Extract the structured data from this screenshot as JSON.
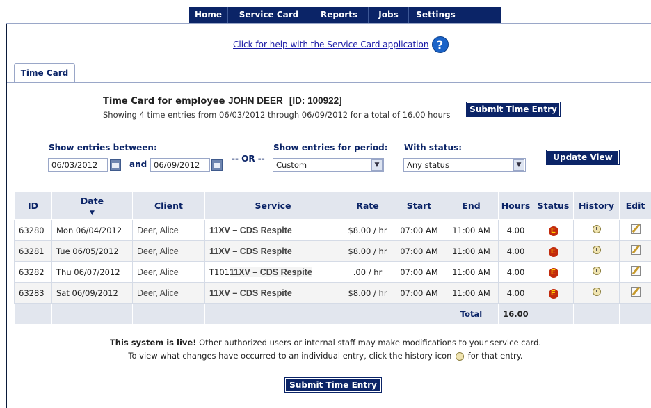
{
  "nav": {
    "items": [
      "Home",
      "Service Card",
      "Reports",
      "Jobs",
      "Settings"
    ]
  },
  "help": {
    "link": "Click for help with the Service Card application"
  },
  "tab": {
    "label": "Time Card"
  },
  "employee": {
    "prefix": "Time Card for employee",
    "name": "JOHN DEER",
    "id_label": "[ID: 100922]",
    "summary": "Showing 4 time entries from 06/03/2012 through 06/09/2012 for a total of 16.00 hours"
  },
  "buttons": {
    "submit_top": "Submit Time Entry",
    "update_view": "Update View",
    "submit_bottom": "Submit Time Entry"
  },
  "filters": {
    "between_label": "Show entries between:",
    "start_date": "06/03/2012",
    "and_label": "and",
    "end_date": "06/09/2012",
    "or_label": "-- OR --",
    "period_label": "Show entries for period:",
    "period_value": "Custom",
    "status_label": "With status:",
    "status_value": "Any status"
  },
  "table": {
    "headers": [
      "ID",
      "Date",
      "Client",
      "Service",
      "Rate",
      "Start",
      "End",
      "Hours",
      "Status",
      "History",
      "Edit"
    ],
    "rows": [
      {
        "id": "63280",
        "date": "Mon 06/04/2012",
        "client": "Deer, Alice",
        "service": "11XV – CDS Respite",
        "rate": "$8.00 / hr",
        "start": "07:00 AM",
        "end": "11:00 AM",
        "hours": "4.00",
        "status": "E"
      },
      {
        "id": "63281",
        "date": "Tue 06/05/2012",
        "client": "Deer, Alice",
        "service": "11XV – CDS Respite",
        "rate": "$8.00 / hr",
        "start": "07:00 AM",
        "end": "11:00 AM",
        "hours": "4.00",
        "status": "E"
      },
      {
        "id": "63282",
        "date": "Thu 06/07/2012",
        "client": "Deer, Alice",
        "service_prefix": "T101",
        "service": "11XV – CDS Respite",
        "rate": ".00 / hr",
        "start": "07:00 AM",
        "end": "11:00 AM",
        "hours": "4.00",
        "status": "E"
      },
      {
        "id": "63283",
        "date": "Sat 06/09/2012",
        "client": "Deer, Alice",
        "service": "11XV – CDS Respite",
        "rate": "$8.00 / hr",
        "start": "07:00 AM",
        "end": "11:00 AM",
        "hours": "4.00",
        "status": "E"
      }
    ],
    "total_label": "Total",
    "total_hours": "16.00"
  },
  "notice": {
    "bold": "This system is live!",
    "line1_rest": " Other authorized users or internal staff may make modifications to your service card.",
    "line2_a": "To view what changes have occurred to an individual entry, click the history icon",
    "line2_b": " for that entry."
  }
}
